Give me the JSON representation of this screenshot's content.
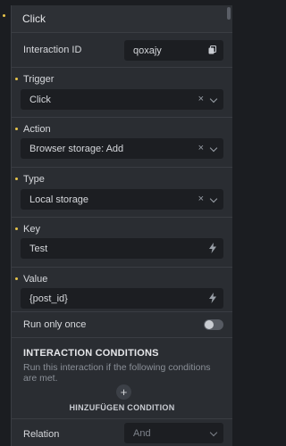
{
  "header": {
    "title": "Click"
  },
  "interaction_id": {
    "label": "Interaction ID",
    "value": "qoxajy",
    "icon": "copy-icon"
  },
  "trigger": {
    "label": "Trigger",
    "value": "Click"
  },
  "action": {
    "label": "Action",
    "value": "Browser storage: Add"
  },
  "type": {
    "label": "Type",
    "value": "Local storage"
  },
  "key": {
    "label": "Key",
    "value": "Test"
  },
  "value_field": {
    "label": "Value",
    "value": "{post_id}"
  },
  "run_once": {
    "label": "Run only once",
    "enabled": false
  },
  "conditions": {
    "title": "INTERACTION CONDITIONS",
    "description": "Run this interaction if the following conditions are met.",
    "add_label": "HINZUFÜGEN CONDITION"
  },
  "relation": {
    "label": "Relation",
    "value": "And"
  },
  "colors": {
    "accent_dot": "#e8c54a",
    "panel": "#2a2d32",
    "field": "#1c1e22"
  }
}
